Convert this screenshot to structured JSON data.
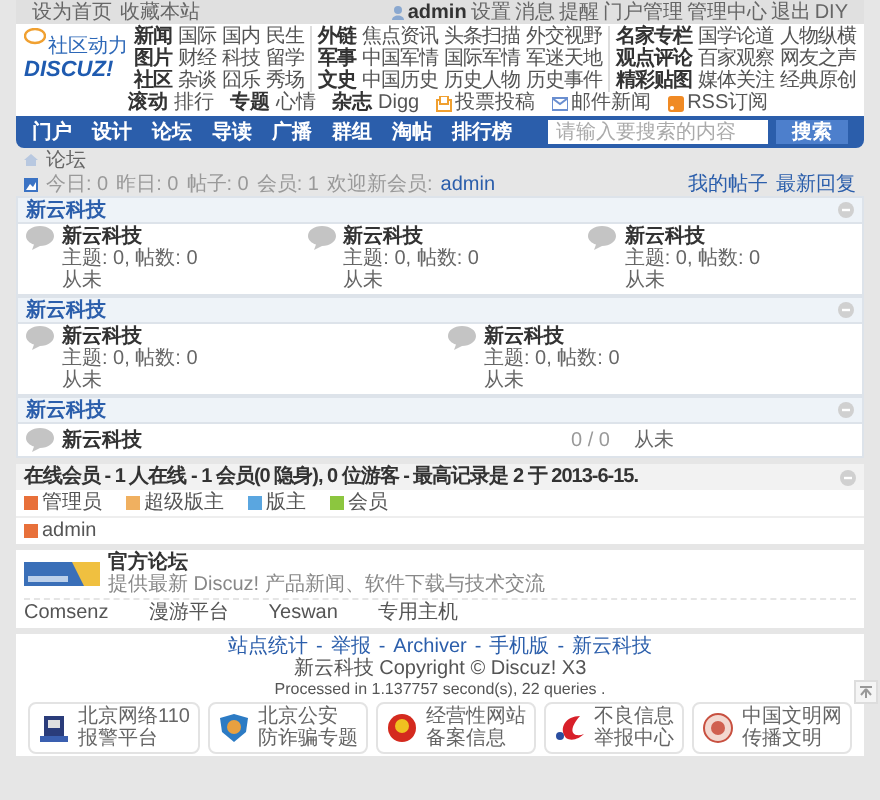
{
  "top_bar": {
    "links": [
      "设为首页",
      "收藏本站"
    ],
    "user": "admin",
    "user_links": [
      "设置",
      "消息",
      "提醒",
      "门户管理",
      "管理中心",
      "退出",
      "DIY"
    ]
  },
  "header": {
    "logo": {
      "tagline": "社区动力",
      "wordmark": "DISCUZ!"
    },
    "link_groups": [
      [
        [
          "新闻",
          "国际",
          "国内",
          "民生"
        ],
        [
          "图片",
          "财经",
          "科技",
          "留学"
        ],
        [
          "社区",
          "杂谈",
          "囧乐",
          "秀场"
        ]
      ],
      [
        [
          "外链",
          "焦点资讯",
          "头条扫描",
          "外交视野"
        ],
        [
          "军事",
          "中国军情",
          "国际军情",
          "军迷天地"
        ],
        [
          "文史",
          "中国历史",
          "历史人物",
          "历史事件"
        ]
      ],
      [
        [
          "名家专栏",
          "国学论道",
          "人物纵横"
        ],
        [
          "观点评论",
          "百家观察",
          "网友之声"
        ],
        [
          "精彩贴图",
          "媒体关注",
          "经典原创"
        ]
      ],
      [
        [
          "滚动",
          "排行"
        ],
        [
          "专题",
          "心情"
        ],
        [
          "杂志",
          "Digg"
        ]
      ]
    ],
    "quick_links": [
      {
        "kind": "vote",
        "label": "投票投稿"
      },
      {
        "kind": "mail",
        "label": "邮件新闻"
      },
      {
        "kind": "rss",
        "label": "RSS订阅"
      }
    ]
  },
  "nav": {
    "items": [
      "门户",
      "设计",
      "论坛",
      "导读",
      "广播",
      "群组",
      "淘帖",
      "排行榜"
    ],
    "search": {
      "placeholder": "请输入要搜索的内容",
      "button": "搜索"
    }
  },
  "breadcrumb": "论坛",
  "stats": {
    "items": [
      "今日: 0",
      "昨日: 0",
      "帖子: 0",
      "会员: 1"
    ],
    "welcome": "欢迎新会员:",
    "new_member": "admin",
    "links": [
      "我的帖子",
      "最新回复"
    ]
  },
  "categories": [
    {
      "title": "新云科技",
      "kind": "grid",
      "forums": [
        {
          "name": "新云科技",
          "counts": "主题: 0, 帖数: 0",
          "last": "从未"
        },
        {
          "name": "新云科技",
          "counts": "主题: 0, 帖数: 0",
          "last": "从未"
        },
        {
          "name": "新云科技",
          "counts": "主题: 0, 帖数: 0",
          "last": "从未"
        }
      ]
    },
    {
      "title": "新云科技",
      "kind": "grid2",
      "forums": [
        {
          "name": "新云科技",
          "counts": "主题: 0, 帖数: 0",
          "last": "从未"
        },
        {
          "name": "新云科技",
          "counts": "主题: 0, 帖数: 0",
          "last": "从未"
        }
      ]
    },
    {
      "title": "新云科技",
      "kind": "list",
      "forums": [
        {
          "name": "新云科技",
          "counts": "0 / 0",
          "last": "从未"
        }
      ]
    }
  ],
  "online": {
    "title": "在线会员 - 1 人在线 - 1 会员(0 隐身), 0 位游客 - 最高记录是 2 于 2013-6-15.",
    "legend": [
      {
        "label": "管理员",
        "color": "#e8703a"
      },
      {
        "label": "超级版主",
        "color": "#f0b060"
      },
      {
        "label": "版主",
        "color": "#5aa6e0"
      },
      {
        "label": "会员",
        "color": "#8cc63f"
      }
    ],
    "users": [
      {
        "name": "admin",
        "color": "#e8703a"
      }
    ]
  },
  "friends": {
    "featured": {
      "name": "官方论坛",
      "description": "提供最新 Discuz! 产品新闻、软件下载与技术交流"
    },
    "links": [
      "Comsenz",
      "漫游平台",
      "Yeswan",
      "专用主机"
    ]
  },
  "footer": {
    "links": [
      "站点统计",
      "举报",
      "Archiver",
      "手机版",
      "新云科技"
    ],
    "separator": "-",
    "copyright": "新云科技 Copyright © Discuz! X3",
    "processed": "Processed in 1.137757 second(s), 22 queries .",
    "badges": [
      {
        "kind": "police",
        "lines": [
          "北京网络110",
          "报警平台"
        ]
      },
      {
        "kind": "shield",
        "lines": [
          "北京公安",
          "防诈骗专题"
        ]
      },
      {
        "kind": "emblem",
        "lines": [
          "经营性网站",
          "备案信息"
        ]
      },
      {
        "kind": "swoosh",
        "lines": [
          "不良信息",
          "举报中心"
        ]
      },
      {
        "kind": "seal",
        "lines": [
          "中国文明网",
          "传播文明"
        ]
      }
    ]
  }
}
